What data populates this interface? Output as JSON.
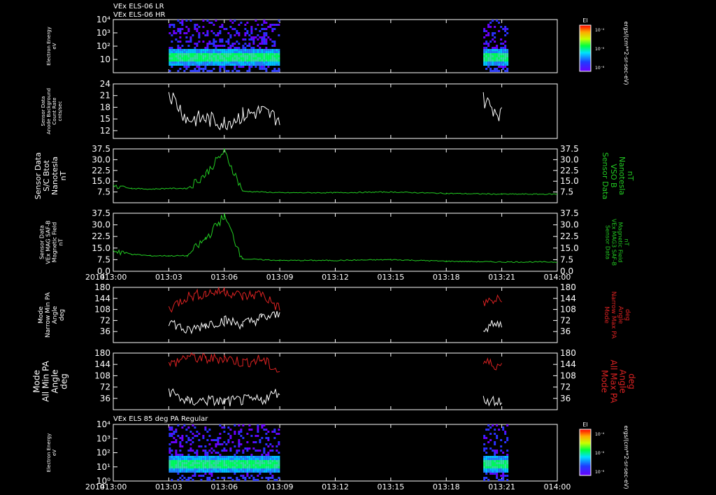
{
  "header": {
    "lines": [
      "VEx ELS-06 LR",
      "VEx ELS-06 HR"
    ]
  },
  "year_label": "2014",
  "time_ticks": [
    "013:00",
    "013:03",
    "013:06",
    "013:09",
    "013:12",
    "013:15",
    "013:18",
    "013:21",
    "014:00"
  ],
  "colors": {
    "background": "#000000",
    "axis": "#ffffff",
    "magnetic": "#22cc22",
    "min_pa": "#ffffff",
    "max_pa": "#dd2222"
  },
  "chart_data": [
    {
      "type": "heatmap",
      "name": "electron-spectrogram-top",
      "ylabel": [
        "Electron Energy",
        "eV"
      ],
      "yscale": "log",
      "ylim": [
        1,
        10000
      ],
      "yticks": [
        "10",
        "10²",
        "10³",
        "10⁴"
      ],
      "data_intervals": [
        [
          "013:03",
          "013:09"
        ],
        [
          "013:20",
          "013:21"
        ]
      ],
      "colorbar": {
        "title": "EI",
        "ticks": [
          "10⁻⁴",
          "10⁻⁶",
          "10⁻⁸"
        ],
        "units": "ergs/(cm**2-sr-sec-eV)"
      }
    },
    {
      "type": "line",
      "name": "anode-background",
      "ylabel": [
        "Sensor Data",
        "Anode Background",
        "Count Rate",
        "cnts/sec"
      ],
      "ylim": [
        10,
        24
      ],
      "yticks": [
        "12",
        "15",
        "18",
        "21",
        "24"
      ],
      "series": [
        {
          "values": [
            {
              "t": "013:03",
              "y": 22
            },
            {
              "t": "013:04",
              "y": 15
            },
            {
              "t": "013:05",
              "y": 15
            },
            {
              "t": "013:06",
              "y": 14
            },
            {
              "t": "013:07",
              "y": 16
            },
            {
              "t": "013:08",
              "y": 17
            },
            {
              "t": "013:09",
              "y": 15
            },
            {
              "t": "013:20",
              "y": 20
            },
            {
              "t": "013:21",
              "y": 16
            }
          ]
        }
      ]
    },
    {
      "type": "line",
      "name": "bnorm-sc",
      "ylabel": [
        "Sensor Data",
        "S/C Btot",
        "Nanotesla",
        "nT"
      ],
      "ylabel_right": [
        "Sensor Data",
        "VSO B",
        "Nanotesla",
        "nT"
      ],
      "ylim": [
        0,
        37.5
      ],
      "yticks": [
        "7.5",
        "15.0",
        "22.5",
        "30.0",
        "37.5"
      ],
      "series": [
        {
          "values": [
            {
              "t": "013:00",
              "y": 13
            },
            {
              "t": "013:01",
              "y": 10
            },
            {
              "t": "013:02",
              "y": 9.5
            },
            {
              "t": "013:03",
              "y": 10
            },
            {
              "t": "013:04",
              "y": 10
            },
            {
              "t": "013:05",
              "y": 20
            },
            {
              "t": "013:06",
              "y": 36
            },
            {
              "t": "013:07",
              "y": 8
            },
            {
              "t": "013:09",
              "y": 7
            },
            {
              "t": "013:12",
              "y": 7
            },
            {
              "t": "013:15",
              "y": 7.5
            },
            {
              "t": "013:18",
              "y": 6.5
            },
            {
              "t": "013:21",
              "y": 6
            },
            {
              "t": "014:00",
              "y": 6
            }
          ]
        }
      ]
    },
    {
      "type": "line",
      "name": "bnorm-saf",
      "ylabel": [
        "Sensor Data",
        "VEx MAG SAF-B",
        "Magnetic Field",
        "nT"
      ],
      "ylabel_right": [
        "Sensor Data",
        "VEx MAG3 SAF-B",
        "Magnetic Field",
        "nT"
      ],
      "ylim": [
        0,
        37.5
      ],
      "yticks": [
        "0.0",
        "7.5",
        "15.0",
        "22.5",
        "30.0",
        "37.5"
      ],
      "series": [
        {
          "values": [
            {
              "t": "013:00",
              "y": 14
            },
            {
              "t": "013:01",
              "y": 11
            },
            {
              "t": "013:02",
              "y": 10
            },
            {
              "t": "013:03",
              "y": 10
            },
            {
              "t": "013:04",
              "y": 10
            },
            {
              "t": "013:05",
              "y": 21
            },
            {
              "t": "013:06",
              "y": 36
            },
            {
              "t": "013:07",
              "y": 8
            },
            {
              "t": "013:09",
              "y": 7
            },
            {
              "t": "013:12",
              "y": 7
            },
            {
              "t": "013:15",
              "y": 7.5
            },
            {
              "t": "013:18",
              "y": 6.5
            },
            {
              "t": "013:21",
              "y": 6
            },
            {
              "t": "014:00",
              "y": 6
            }
          ]
        }
      ]
    },
    {
      "type": "line",
      "name": "narrow-pa",
      "ylabel": [
        "Mode",
        "Narrow Min PA",
        "Angle",
        "deg"
      ],
      "ylabel_right": [
        "Mode",
        "Narrow Max PA",
        "Angle",
        "deg"
      ],
      "ylim": [
        0,
        180
      ],
      "yticks": [
        "36",
        "72",
        "108",
        "144",
        "180"
      ],
      "series": [
        {
          "values": [
            {
              "t": "013:03",
              "y": 72
            },
            {
              "t": "013:04",
              "y": 36
            },
            {
              "t": "013:05",
              "y": 60
            },
            {
              "t": "013:06",
              "y": 72
            },
            {
              "t": "013:07",
              "y": 60
            },
            {
              "t": "013:08",
              "y": 80
            },
            {
              "t": "013:09",
              "y": 90
            },
            {
              "t": "013:20",
              "y": 50
            },
            {
              "t": "013:21",
              "y": 60
            }
          ]
        },
        {
          "values": [
            {
              "t": "013:03",
              "y": 110
            },
            {
              "t": "013:04",
              "y": 150
            },
            {
              "t": "013:05",
              "y": 160
            },
            {
              "t": "013:06",
              "y": 170
            },
            {
              "t": "013:07",
              "y": 150
            },
            {
              "t": "013:08",
              "y": 160
            },
            {
              "t": "013:09",
              "y": 110
            },
            {
              "t": "013:20",
              "y": 130
            },
            {
              "t": "013:21",
              "y": 140
            }
          ]
        }
      ]
    },
    {
      "type": "line",
      "name": "all-pa",
      "ylabel": [
        "Mode",
        "All Min PA",
        "Angle",
        "deg"
      ],
      "ylabel_right": [
        "Mode",
        "All Max PA",
        "Angle",
        "deg"
      ],
      "ylim": [
        0,
        180
      ],
      "yticks": [
        "36",
        "72",
        "108",
        "144",
        "180"
      ],
      "series": [
        {
          "values": [
            {
              "t": "013:03",
              "y": 60
            },
            {
              "t": "013:04",
              "y": 25
            },
            {
              "t": "013:05",
              "y": 30
            },
            {
              "t": "013:06",
              "y": 25
            },
            {
              "t": "013:07",
              "y": 30
            },
            {
              "t": "013:08",
              "y": 30
            },
            {
              "t": "013:09",
              "y": 60
            },
            {
              "t": "013:20",
              "y": 30
            },
            {
              "t": "013:21",
              "y": 30
            }
          ]
        },
        {
          "values": [
            {
              "t": "013:03",
              "y": 140
            },
            {
              "t": "013:04",
              "y": 170
            },
            {
              "t": "013:05",
              "y": 160
            },
            {
              "t": "013:06",
              "y": 165
            },
            {
              "t": "013:07",
              "y": 150
            },
            {
              "t": "013:08",
              "y": 160
            },
            {
              "t": "013:09",
              "y": 120
            },
            {
              "t": "013:20",
              "y": 150
            },
            {
              "t": "013:21",
              "y": 140
            }
          ]
        }
      ]
    },
    {
      "type": "heatmap",
      "name": "electron-spectrogram-85deg",
      "title": "VEx ELS 85 deg PA Regular",
      "ylabel": [
        "Electron Energy",
        "eV"
      ],
      "yscale": "log",
      "ylim": [
        1,
        10000
      ],
      "yticks": [
        "10⁰",
        "10¹",
        "10²",
        "10³",
        "10⁴"
      ],
      "data_intervals": [
        [
          "013:03",
          "013:09"
        ],
        [
          "013:20",
          "013:21"
        ]
      ],
      "colorbar": {
        "title": "EI",
        "ticks": [
          "10⁻⁴",
          "10⁻⁶",
          "10⁻⁸"
        ],
        "units": "ergs/(cm**2-sr-sec-eV)"
      }
    }
  ]
}
